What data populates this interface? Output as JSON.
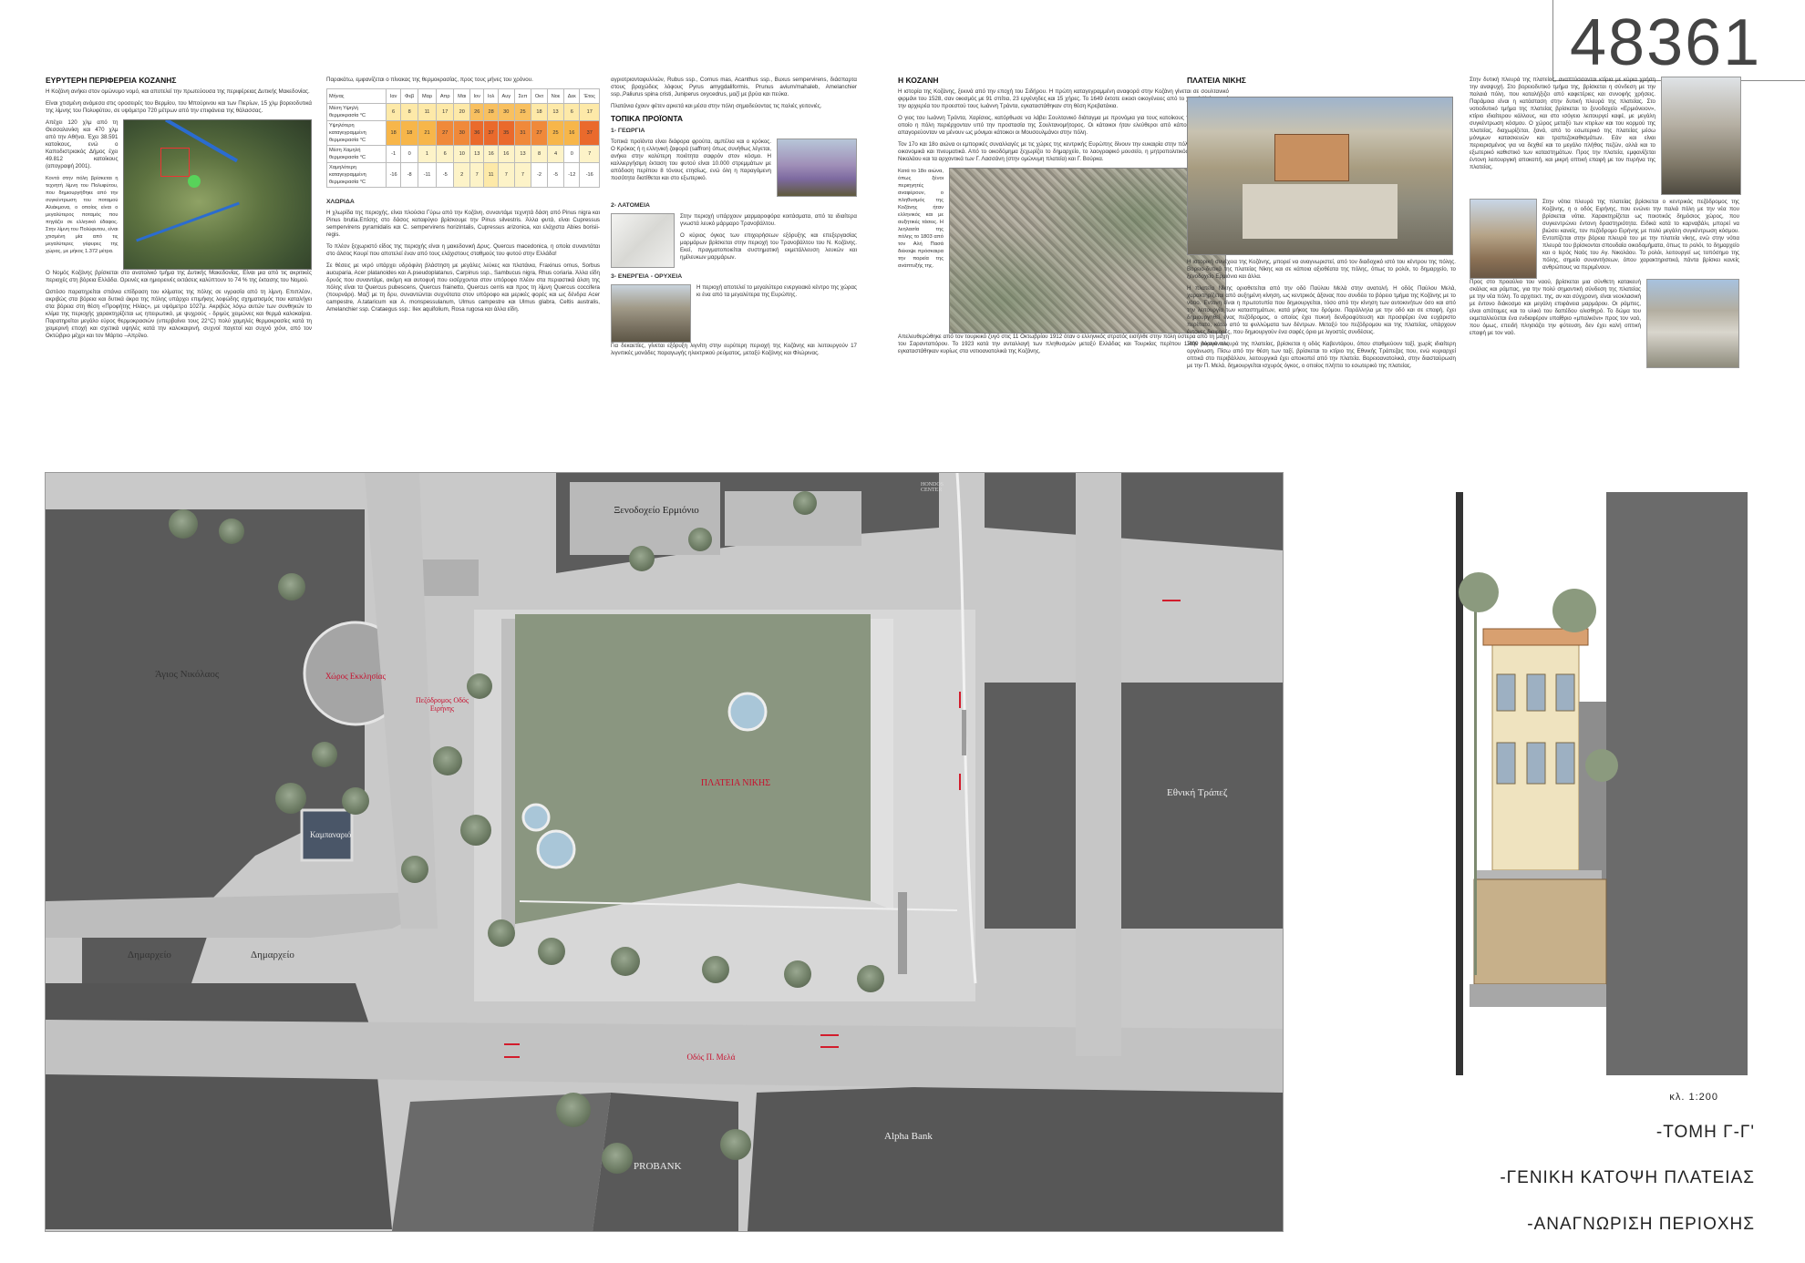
{
  "project_number": "48361",
  "columns": {
    "region": {
      "title": "ΕΥΡΥΤΕΡΗ ΠΕΡΙΦΕΡΕΙΑ ΚΟΖΑΝΗΣ",
      "p1": "Η Κοζάνη ανήκει στον ομώνυμο νομό, και αποτελεί την πρωτεύουσα της περιφέρειας Δυτικής Μακεδονίας.",
      "p2": "Είναι χτισμένη ανάμεσα στις οροσειρές του Βερμίου, του Μπούρινου και των Πιερίων, 15 χλμ βορειοδυτικά της λίμνης του Πολυφύτου, σε υψόμετρο 720 μέτρων από την επιφάνεια της θάλασσας.",
      "p3": "Απέχει 120 χλμ από τη Θεσσαλονίκη και 470 χλμ από την Αθήνα. Έχει 38.591 κατοίκους, ενώ ο Καποδιστριακός Δήμος έχει 49.812 κατοίκους (απογραφή 2001).",
      "p4": "Κοντά στην πόλη βρίσκεται η τεχνητή λίμνη του Πολυφύτου, που δημιουργήθηκε από την συγκέντρωση του ποταμού Αλιάκμονα, ο οποίος είναι ο μεγαλύτερος ποταμός που πηγάζει σε ελληνικό έδαφος. Στην λίμνη του Πολύφυτου, είναι χτισμένη μία από τις μεγαλύτερες γέφυρες της χώρας, με μήκος 1.372 μέτρα.",
      "p5": "Ο Νομός Κοζάνης βρίσκεται στο ανατολικό τμήμα της Δυτικής Μακεδονίας. Είναι μια από τις ακριτικές περιοχές στη βόρεια Ελλάδα. Ορεινές και ημιορεινές εκτάσεις καλύπτουν το 74 % της έκτασης του Νομού.",
      "p6": "Ωστόσο παρατηρείται σπάνια επίδραση του κλίματος της πόλης σε υγρασία από τη λίμνη. Επιπλέον, ακριβώς στα βόρεια και δυτικά άκρα της πόλης υπάρχει επιμήκης λοφώδης σχηματισμός που καταλήγει στα βόρεια στη θέση «Προφήτης Ηλίας», με υψόμετρο 1027μ. Ακριβώς λόγω αυτών των συνθηκών το κλίμα της περιοχής χαρακτηρίζεται ως ηπειρωτικό, με ψυχρούς - δριμύς χειμώνες και θερμά καλοκαίρια. Παρατηρείται μεγάλο εύρος θερμοκρασιών (υπερβαίνει τους 22°C) πολύ χαμηλές θερμοκρασίες κατά τη χειμερινή εποχή και σχετικά υψηλές κατά την καλοκαιρινή, συχνοί παγετοί και συχνό χιόνι, από τον Οκτώβριο μέχρι και τον Μάρτιο –Απρίλιο."
    },
    "climate": {
      "intro": "Παρακάτω, εμφανίζεται ο πίνακας της θερμοκρασίας, προς τους μήνες του χρόνου.",
      "header": [
        "Μήνας",
        "Ιαν",
        "Φεβ",
        "Μαρ",
        "Απρ",
        "Μαι",
        "Ιον",
        "Ιολ",
        "Αυγ",
        "Σεπ",
        "Οκτ",
        "Νοε",
        "Δεκ",
        "Έτος"
      ],
      "rows": [
        {
          "label": "Μέση Υψηλή θερμοκρασία °C",
          "values": [
            "6",
            "8",
            "11",
            "17",
            "20",
            "26",
            "28",
            "30",
            "25",
            "18",
            "13",
            "6",
            "17"
          ]
        },
        {
          "label": "Υψηλότερη καταγεγραμμένη θερμοκρασία °C",
          "values": [
            "18",
            "18",
            "21",
            "27",
            "30",
            "36",
            "37",
            "35",
            "31",
            "27",
            "25",
            "16",
            "37"
          ]
        },
        {
          "label": "Μέση Χαμηλή θερμοκρασία °C",
          "values": [
            "-1",
            "0",
            "1",
            "6",
            "10",
            "13",
            "16",
            "16",
            "13",
            "8",
            "4",
            "0",
            "7"
          ]
        },
        {
          "label": "Χαμηλότερη καταγεγραμμένη θερμοκρασία °C",
          "values": [
            "-16",
            "-8",
            "-11",
            "-5",
            "2",
            "7",
            "11",
            "7",
            "7",
            "-2",
            "-5",
            "-12",
            "-16"
          ]
        }
      ],
      "veg_title": "ΧΛΩΡΙΔΑ",
      "veg_p1": "Η χλωρίδα της περιοχής, είναι πλούσια Γύρω από την Κοζάνη, συναντάμε τεχνητά δάση από Pinus nigra και Pinus brutia.Επίσης στο δάσος καταφύγιο βρίσκουμε την Pinus silvestris. Άλλα φυτά, είναι Cupressus sempervirens pyramidalis και C. sempervirens horizintalis, Cupressus arizonica, και ελάχιστα Abies borisii-regis.",
      "veg_p2": "Το πλέον ξεχωριστό είδος της περιοχής είναι η μακεδονική Δρυς. Quercus macedonica, η οποία συναντάται στο άλσος Κουρί που αποτελεί έναν από τους ελάχιστους σταθμούς του φυτού στην Ελλάδα!",
      "veg_p3": "Σε θέσεις με νερό υπάρχει υδρόφιλη βλάστηση με μεγάλες λεύκες και πλατάνια, Fraxinus ornus, Sorbus aucuparia, Acer platanoides και A.pseudoplatanus, Carpinus ssp., Sambucus nigra, Rhus coriaria. Άλλα είδη δρυός που συναντάμε, ακόμη και αυτοφυή που εισέρχονται στον υπόροφο πλέον στα περιαστικά άλση της πόλης είναι τα Quercus pubescens, Quercus frainetto, Quercus cerris και προς τη λίμνη Quercus coccifera (πουρνάρι). Μαζί με τη δρυ, συναντώνται συχνότατα στον υπόροφο και μερικές φορές και ως δένδρα Acer campestre, A.tataricum και A. monspessulanum, Ulmus campestre και Ulmus glabra, Celtis australis, Amelanchier ssp. Crataegus ssp.: Ilex aquifolium, Rosa rugosa και άλλα είδη."
    },
    "products": {
      "p0": "αγριοτριανταφυλλιών, Rubus ssp., Cornus mas, Acanthus ssp., Buxus sempervirens, διάσπαρτα στους βραχώδεις λόφους Pyrus amygdaliformis, Prunus avium/mahaleb, Amelanchier ssp.,Paliurus spina cristi, Juniperus oxycedrus, μαζί με βρύα και πεύκα.",
      "p00": "Πλατάνια έχουν φέτεν αρκετά και μέσα στην πόλη σημαδεύοντας τις παλιές γειτονιές.",
      "title": "ΤΟΠΙΚΑ ΠΡΟΪΟΝΤΑ",
      "s1": "1- ΓΕΩΡΓΙΑ",
      "s1p": "Τοπικά προϊόντα είναι διάφορα φρούτα, αμπέλια και ο κρόκος. Ο Κρόκος ή η ελληνική ζαφορά (saffron) όπως συνήθως λέγεται, ανήκει στην καλύτερη ποιότητα σαφρόν στον κόσμο. Η καλλιεργήσιμη έκταση του φυτού είναι 10.000 στρεμμάτων με απόδοση περίπου 8 τόνους ετησίως, ενώ όλη η παραγόμενη ποσότητα διατίθεται και στο εξωτερικό.",
      "s2": "2- ΛΑΤΟΜΕΙΑ",
      "s2p": "Στην περιοχή υπάρχουν μαρμαροφόρα κοιτάσματα, από τα ιδιαίτερα γνωστά λευκό μάρμαρο Τρανοβάλτου.",
      "s2p2": "Ο κύριος όγκος των επιχειρήσεων εξόρυξης και επεξεργασίας μαρμάρων βρίσκεται στην περιοχή του Τρανοβάλτου του Ν. Κοζάνης. Εκεί, πραγματοποιείται συστηματική εκμετάλλευση λευκών και ημίλευκων μαρμάρων.",
      "s3": "3- ΕΝΕΡΓΕΙΑ - ΟΡΥΧΕΙΑ",
      "s3p": "Η περιοχή αποτελεί το μεγαλύτερο ενεργειακό κέντρο της χώρας κι ένα από τα μεγαλύτερα της Ευρώπης.",
      "s3p2": "Για δεκαετίες, γίνεται εξόρυξη λιγνίτη στην ευρύτερη περιοχή της Κοζάνης και λειτουργούν 17 λιγνιτικές μονάδες παραγωγής ηλεκτρικού ρεύματος, μεταξύ Κοζάνης και Φλώρινας."
    },
    "kozani": {
      "title": "Η ΚΟΖΑΝΗ",
      "p1": "Η ιστορία της Κοζάνης, ξεκινά από την εποχή του Σιδήρου. Η πρώτη καταγεγραμμένη αναφορά στην Κοζάνη γίνεται σε σουλτανικό φιρμάνι του 1528, σαν οικισμός με 91 σπίτια, 23 εργένηδες και 15 χήρες. Το 1649 έκτοτε εικοσι οικογένειες από το χωριό Κτένι, από την αρχιερέα του προεστού τους Ιωάννη Τράντα, εγκαταστάθηκαν στη θέση Κρεβατάκια.",
      "p2": "Ο γιος του Ιωάννη Τράντα, Χαρίσιος, κατόρθωσε να λάβει Σουλτανικό διάταγμα με προνόμια για τους κατοίκους της πόλης, με το οποίο η πόλη περιέρχονταν υπό την προστασία της Σουλτανομήτορος. Οι κάτοικοι ήταν ελεύθεροι από κάποιους φόρους και απαγορεύονταν να μένουν ως μόνιμοι κάτοικοι οι Μουσουλμάνοι στην πόλη.",
      "p3": "Τον 17ο και 18ο αιώνα οι εμπορικές συναλλαγές με τις χώρες της κεντρικής Ευρώπης δίνουν την ευκαιρία στην πόλη να αναπτυχθεί οικονομικά και πνευματικά. Από το οικοδόμημα ξεχωρίζει το δημαρχείο, το λαογραφικό μουσείο, η μητροπολιτικός ναός του Αγίου Νικολάου και τα αρχοντικά των Γ. Λασσάνη (στην ομώνυμη πλατεία) και Γ. Βούρκα.",
      "p4": "Κατά το 18ο αιώνα, όπως ξένοι περιηγητές αναφέρουν, ο πληθυσμός της Κοζάνης ήταν ελληνικός και με αυξητικές τάσεις. Η λεηλασία της πόλης το 1803 από τον Αλή Πασά διέκοψε πρόσκαιρα την πορεία της ανάπτυξής της.",
      "p5": "Απελευθερώθηκε από τον τουρκικό ζυγό στις 11 Οκτωβρίου 1912 όταν ο ελληνικός στρατός εισήλθε στην πόλη ύστερα από τη μάχη του Σαρανταπόρου. Το 1923 κατά την ανταλλαγή των πληθυσμών μεταξύ Ελλάδας και Τουρκίας περίπου 1.400 οικογένειες εγκαταστάθηκαν κυρίως στα νοτιοανατολικά της Κοζάνης."
    },
    "nikis": {
      "title": "ΠΛΑΤΕΙΑ ΝΙΚΗΣ",
      "p1": "Η ιστορική συνέχεια της Κοζάνης, μπορεί να αναγνωριστεί, από τον διαδοχικό ιστό του κέντρου της πόλης. Βορειο-δυτικά της πλατείας Νίκης και σε κάποια αξιοθέατα της πόλης, όπως το ρολόι, το δημαρχείο, το ξενοδοχείο Ερμιόνιο και άλλα.",
      "p2": "Η πλατεία Νίκης οριοθετείται από την οδό Παύλου Μελά στην ανατολή. Η οδός Παύλου Μελά, χαρακτηρίζεται από αυξημένη κίνηση, ως κεντρικός άξονας που συνδέει το βόρειο τμήμα της Κοζάνης με το νότιο. Έντονη είναι η πρωτοτυπία που δημιουργείται, τόσο από την κίνηση των αυτοκινήτων όσο και από την λειτουργία των καταστημάτων, κατά μήκος του δρόμου. Παράλληλα με την οδό και σε επαφή, έχει δημιουργηθεί ένας πεζόδρομος, ο οποίος έχει πυκνή δενδροφύτευση και προσφέρει ένα ευχάριστο περίπατο, κάτω από τα φυλλώματα των δέντρων. Μεταξύ του πεζόδρομου και της πλατείας, υπάρχουν έντονες διαφορές, που δημιουργούν ένα σαφές όριο με λιγοστές συνδέσεις.",
      "p3": "Στην βόρεια πλευρά της πλατείας, βρίσκεται η οδός Καβεντάρου, όπου σταθμεύουν ταξί, χωρίς ιδιαίτερη οργάνωση. Πίσω από την θέση των ταξί, βρίσκεται το κτίριο της Εθνικής Τράπεζας που, ενώ κυριαρχεί οπτικά στο περιβάλλον, λειτουργικά έχει αποκοπεί από την πλατεία. Βορειοανατολικά, στην διασταύρωση με την Π. Μελά, δημιουργείται ισχυρός όγκος, ο οποίος πλήττει το εσωτερικό της πλατείας."
    },
    "nikis2": {
      "p1": "Στην δυτική πλευρά της πλατείας, αναπτύσσονται κτίρια με κύρια χρήση την αναψυχή. Στο βορειοδυτικό τμήμα της, βρίσκεται η σύνδεση με την παλαιά πόλη, που καταλήξιζει από καφετέριες και συνοφής χρήσεις. Παράμοια είναι η κατάσταση στην δυτική πλευρά της πλατείας. Στο νοτιοδυτικό τμήμα της πλατείας βρίσκεται το ξενοδοχείο «Ερμιόνειον», κτίριο ιδιαίτερου κάλλους, και στο ισόγειο λειτουργεί καφέ, με μεγάλη συγκέντρωση κόσμου. Ο χώρος μεταξύ των κτιρίων και του κορμού της πλατείας, διαχωρίζεται, ξανά, από το εσωτερικό της πλατείας μέσω μόνιμων κατασκευών και τραπεζοκαθισμάτων. Εάν και είναι περιορισμένος για να δεχθεί και το μεγάλο πλήθος πεζών, αλλά και το εξωτερικό καθιστικό των καταστημάτων. Προς την πλατεία, εμφανίζεται έντονη λειτουργική αποκοπή, και μικρή οπτική επαφή με τον πυρήνα της πλατείας.",
      "p2": "Στην νότια πλευρά της πλατείας βρίσκεται ο κεντρικός πεζόδρομος της Κοζάνης, η ο οδός Ειρήνης, που ενώνει την παλιά πόλη με την νέα που βρίσκεται νότια. Χαρακτηρίζεται ως ποιοτικός δημόσιος χώρος, που συγκεντρώνει έντονη δραστηριότητα. Ειδικά κατά το καρναβάλι, μπορεί να βιώσει κανείς, τον πεζόδρομο Ειρήνης με πολύ μεγάλη συγκέντρωση κόσμου. Εντοπίζεται στην βόρεια πλευρά του με την πλατεία νίκης, ενώ στην νότια πλευρά του βρίσκονται σπουδαία οικοδομήματα, όπως το ρολόι, το δημαρχείο και ο Ιερός Ναός του Αγ. Νικολάου. Το ρολόι, λειτουργεί ως τοπόσημο της πόλης, σημείο συναντήσεων, όπου χαρακτηριστικά, πάντα βρίσκει κανείς ανθρώπους να περιμένουν.",
      "p3": "Προς στο προαύλιο του ναού, βρίσκεται μια σύνθετη κατακευή σκάλας και ράμπας, για την πολύ σημαντική σύνδεση της πλατείας με την νέα πόλη. Το αρχιτεκτ. της, αν και σύγχρονη, είναι νεοκλασική με έντονο διάκοσμο και μεγάλη επιφάνεια μαρμάρου. Οι ράμπες, είναι απότομες και το υλικό του δαπέδου ολισθηρό. Το δώμα του εκμεταλλεύεται ένα ενδιαφέρον υπαίθριο «μπαλκόνι» προς τον ναό, που όμως, επειδή πλησιάζει την φύτευση, δεν έχει καλή οπτική επαφή με τον ναό."
    }
  },
  "plan": {
    "labels": {
      "church": "Άγιος Νικόλαος",
      "church_yard": "Χώρος Εκκλησίας",
      "bell_tower": "Καμπαναριό",
      "town_hall_1": "Δημαρχείο",
      "town_hall_2": "Δημαρχείο",
      "hotel": "Ξενοδοχείο Ερμιόνιο",
      "national_bank": "Εθνική Τράπεζ",
      "square": "ΠΛΑΤΕΙΑ ΝΙΚΗΣ",
      "pedestrian": "Πεζόδρομος Οδός Ειρήνης",
      "street": "Οδός Π. Μελά",
      "probank": "PROBANK",
      "alpha": "Alpha Bank",
      "hondos": "HONDOS CENTER"
    }
  },
  "legend": {
    "scale": "κλ. 1:200",
    "items": [
      "-ΤΟΜΗ Γ-Γ'",
      "-ΓΕΝΙΚΗ ΚΑΤΟΨΗ ΠΛΑΤΕΙΑΣ",
      "-ΑΝΑΓΝΩΡΙΣΗ ΠΕΡΙΟΧΗΣ"
    ]
  }
}
